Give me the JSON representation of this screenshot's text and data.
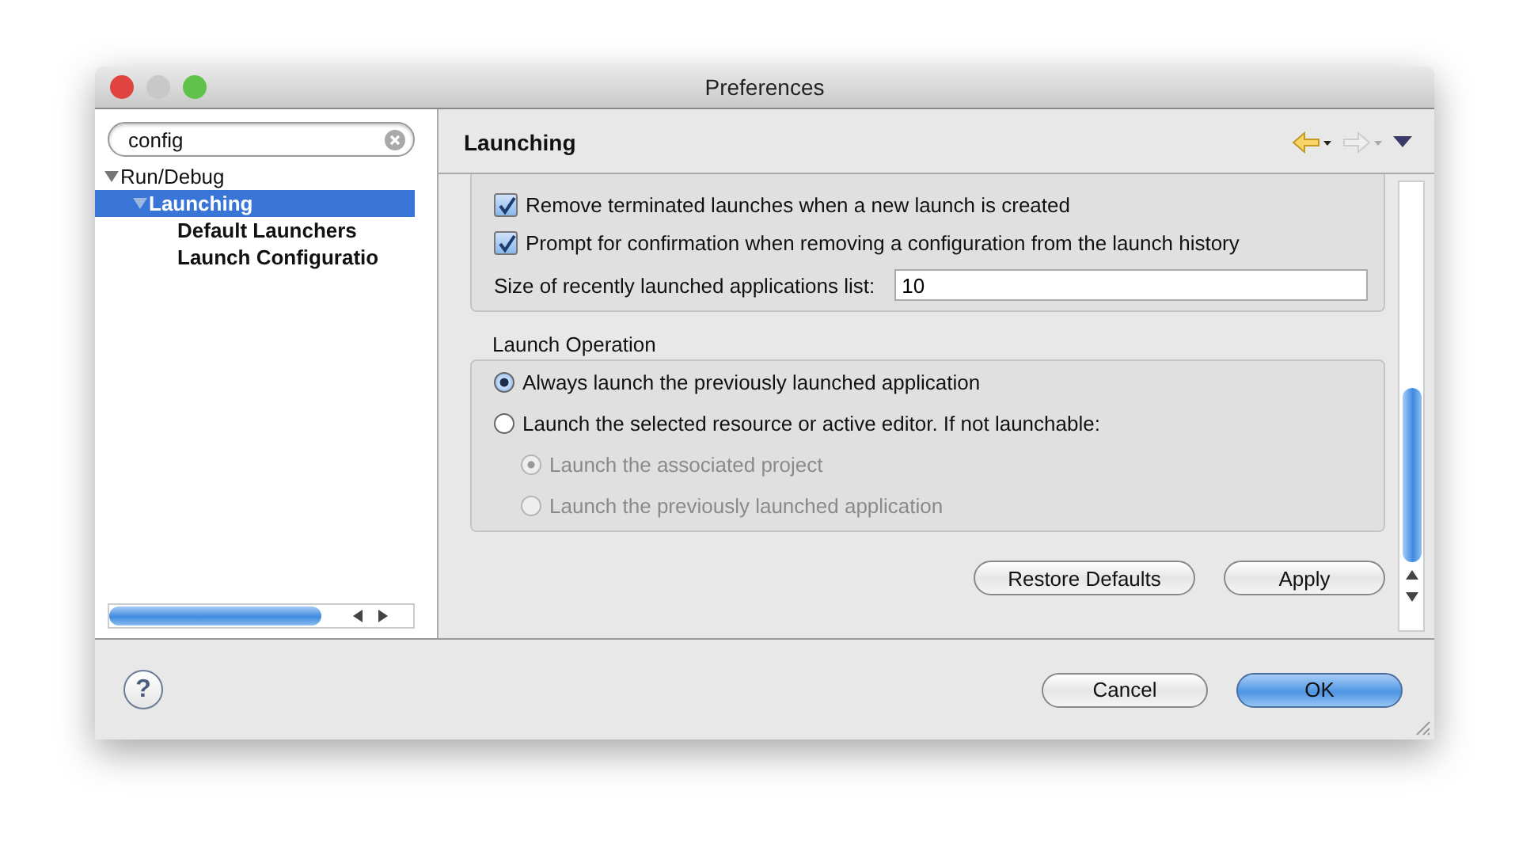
{
  "window": {
    "title": "Preferences"
  },
  "filter": {
    "value": "config"
  },
  "tree": [
    {
      "label": "Run/Debug",
      "expanded": true,
      "selected": false,
      "children": [
        {
          "label": "Launching",
          "expanded": true,
          "selected": true,
          "children": [
            {
              "label": "Default Launchers",
              "selected": false
            },
            {
              "label": "Launch Configuratio",
              "selected": false
            }
          ]
        }
      ]
    }
  ],
  "page": {
    "title": "Launching"
  },
  "options": [
    {
      "label": "Remove terminated launches when a new launch is created",
      "checked": true
    },
    {
      "label": "Prompt for confirmation when removing a configuration from the launch history",
      "checked": true
    }
  ],
  "history_size": {
    "label": "Size of recently launched applications list:",
    "value": "10"
  },
  "launch_operation": {
    "title": "Launch Operation",
    "choices": [
      {
        "label": "Always launch the previously launched application",
        "selected": true,
        "disabled": false
      },
      {
        "label": "Launch the selected resource or active editor. If not launchable:",
        "selected": false,
        "disabled": false,
        "children": [
          {
            "label": "Launch the associated project",
            "selected": true,
            "disabled": true
          },
          {
            "label": "Launch the previously launched application",
            "selected": false,
            "disabled": true
          }
        ]
      }
    ]
  },
  "page_buttons": [
    {
      "label": "Restore Defaults",
      "default": false
    },
    {
      "label": "Apply",
      "default": false
    }
  ],
  "help_button": {
    "label": "?"
  },
  "dialog_buttons": [
    {
      "label": "Cancel",
      "default": false
    },
    {
      "label": "OK",
      "default": true
    }
  ]
}
